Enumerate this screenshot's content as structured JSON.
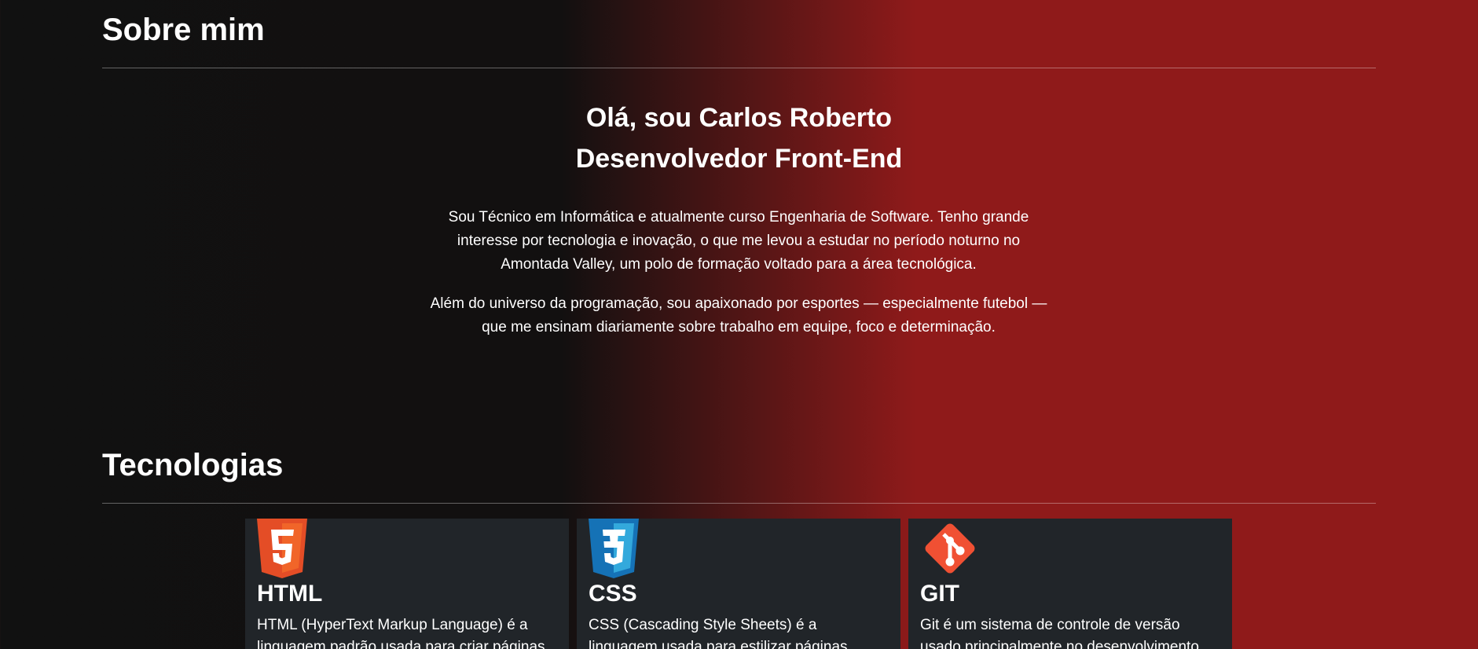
{
  "about": {
    "section_title": "Sobre mim",
    "greeting": "Olá, sou Carlos Roberto",
    "role": "Desenvolvedor Front-End",
    "paragraph1": "Sou Técnico em Informática e atualmente curso Engenharia de Software. Tenho grande interesse por tecnologia e inovação, o que me levou a estudar no período noturno no Amontada Valley, um polo de formação voltado para a área tecnológica.",
    "paragraph2": "Além do universo da programação, sou apaixonado por esportes — especialmente futebol — que me ensinam diariamente sobre trabalho em equipe, foco e determinação."
  },
  "technologies": {
    "section_title": "Tecnologias",
    "cards": [
      {
        "icon": "html5-logo-icon",
        "title": "HTML",
        "text": "HTML (HyperText Markup Language) é a linguagem padrão usada para criar páginas"
      },
      {
        "icon": "css3-logo-icon",
        "title": "CSS",
        "text": "CSS (Cascading Style Sheets) é a linguagem usada para estilizar páginas"
      },
      {
        "icon": "git-logo-icon",
        "title": "GIT",
        "text": "Git é um sistema de controle de versão usado principalmente no desenvolvimento"
      }
    ]
  },
  "colors": {
    "background_dark": "#111111",
    "background_red": "#8f1a1a",
    "card_background": "#212529",
    "html_orange": "#e44d26",
    "css_blue": "#1572b6",
    "git_orange": "#f05033"
  }
}
